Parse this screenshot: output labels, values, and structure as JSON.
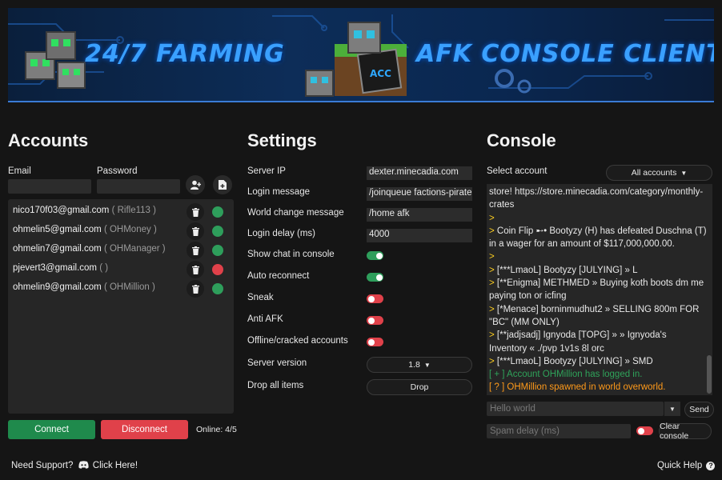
{
  "banner": {
    "left_text": "24/7 FARMING",
    "right_text": "AFK CONSOLE CLIENT",
    "badge": "ACC"
  },
  "accounts": {
    "title": "Accounts",
    "email_label": "Email",
    "password_label": "Password",
    "email_value": "",
    "password_value": "",
    "list": [
      {
        "email": "nico170f03@gmail.com",
        "alias": "( Rifle113 )",
        "status": "online",
        "status_color": "#2e9e5b"
      },
      {
        "email": "ohmelin5@gmail.com",
        "alias": "( OHMoney )",
        "status": "online",
        "status_color": "#2e9e5b"
      },
      {
        "email": "ohmelin7@gmail.com",
        "alias": "( OHManager )",
        "status": "online",
        "status_color": "#2e9e5b"
      },
      {
        "email": "pjevert3@gmail.com",
        "alias": "( )",
        "status": "offline",
        "status_color": "#e0414a"
      },
      {
        "email": "ohmelin9@gmail.com",
        "alias": "( OHMillion )",
        "status": "online",
        "status_color": "#2e9e5b"
      }
    ],
    "connect_label": "Connect",
    "disconnect_label": "Disconnect",
    "online_text": "Online: 4/5"
  },
  "settings": {
    "title": "Settings",
    "server_ip_label": "Server IP",
    "server_ip": "dexter.minecadia.com",
    "login_message_label": "Login message",
    "login_message": "/joinqueue factions-pirate",
    "world_change_label": "World change message",
    "world_change": "/home afk",
    "login_delay_label": "Login delay (ms)",
    "login_delay": "4000",
    "toggles": [
      {
        "label": "Show chat in console",
        "on": true
      },
      {
        "label": "Auto reconnect",
        "on": true
      },
      {
        "label": "Sneak",
        "on": false
      },
      {
        "label": "Anti AFK",
        "on": false
      },
      {
        "label": "Offline/cracked accounts",
        "on": false
      }
    ],
    "server_version_label": "Server version",
    "server_version": "1.8",
    "drop_all_label": "Drop all items",
    "drop_button": "Drop"
  },
  "console": {
    "title": "Console",
    "select_label": "Select account",
    "select_value": "All accounts",
    "lines": [
      {
        "kind": "plain",
        "text": "store! https://store.minecadia.com/category/monthly-crates"
      },
      {
        "kind": "gt",
        "text": ""
      },
      {
        "kind": "gt",
        "text": "Coin Flip ➸• Bootyzy (H) has defeated Duschna (T) in a wager for an amount of $117,000,000.00."
      },
      {
        "kind": "gt",
        "text": ""
      },
      {
        "kind": "gt",
        "text": "[***LmaoL] Bootyzy [JULYING] » L"
      },
      {
        "kind": "gt",
        "text": "[**Enigma] METHMED » Buying koth boots dm me paying ton or icfing"
      },
      {
        "kind": "gt",
        "text": "[*Menace] borninmudhut2 » SELLING 800m FOR \"BC\" (MM ONLY)"
      },
      {
        "kind": "gt",
        "text": "[**jadjsadj] Ignyoda [TOPG] » » Ignyoda's Inventory « ./pvp 1v1s 8l orc"
      },
      {
        "kind": "gt",
        "text": "[***LmaoL] Bootyzy [JULYING] » SMD"
      },
      {
        "kind": "green",
        "text": "[ + ] Account OHMillion has logged in."
      },
      {
        "kind": "orange",
        "text": "[ ? ] OHMillion spawned in world overworld."
      }
    ],
    "chat_placeholder": "Hello world",
    "send_label": "Send",
    "spam_placeholder": "Spam delay (ms)",
    "spam_toggle_on": false,
    "clear_label": "Clear console"
  },
  "footer": {
    "support_text": "Need Support?",
    "support_link": "Click Here!",
    "quick_help": "Quick Help"
  },
  "colors": {
    "green": "#1f8a4c",
    "red": "#e0414a",
    "toggle_on": "#2e9e5b",
    "toggle_off": "#e0414a"
  }
}
